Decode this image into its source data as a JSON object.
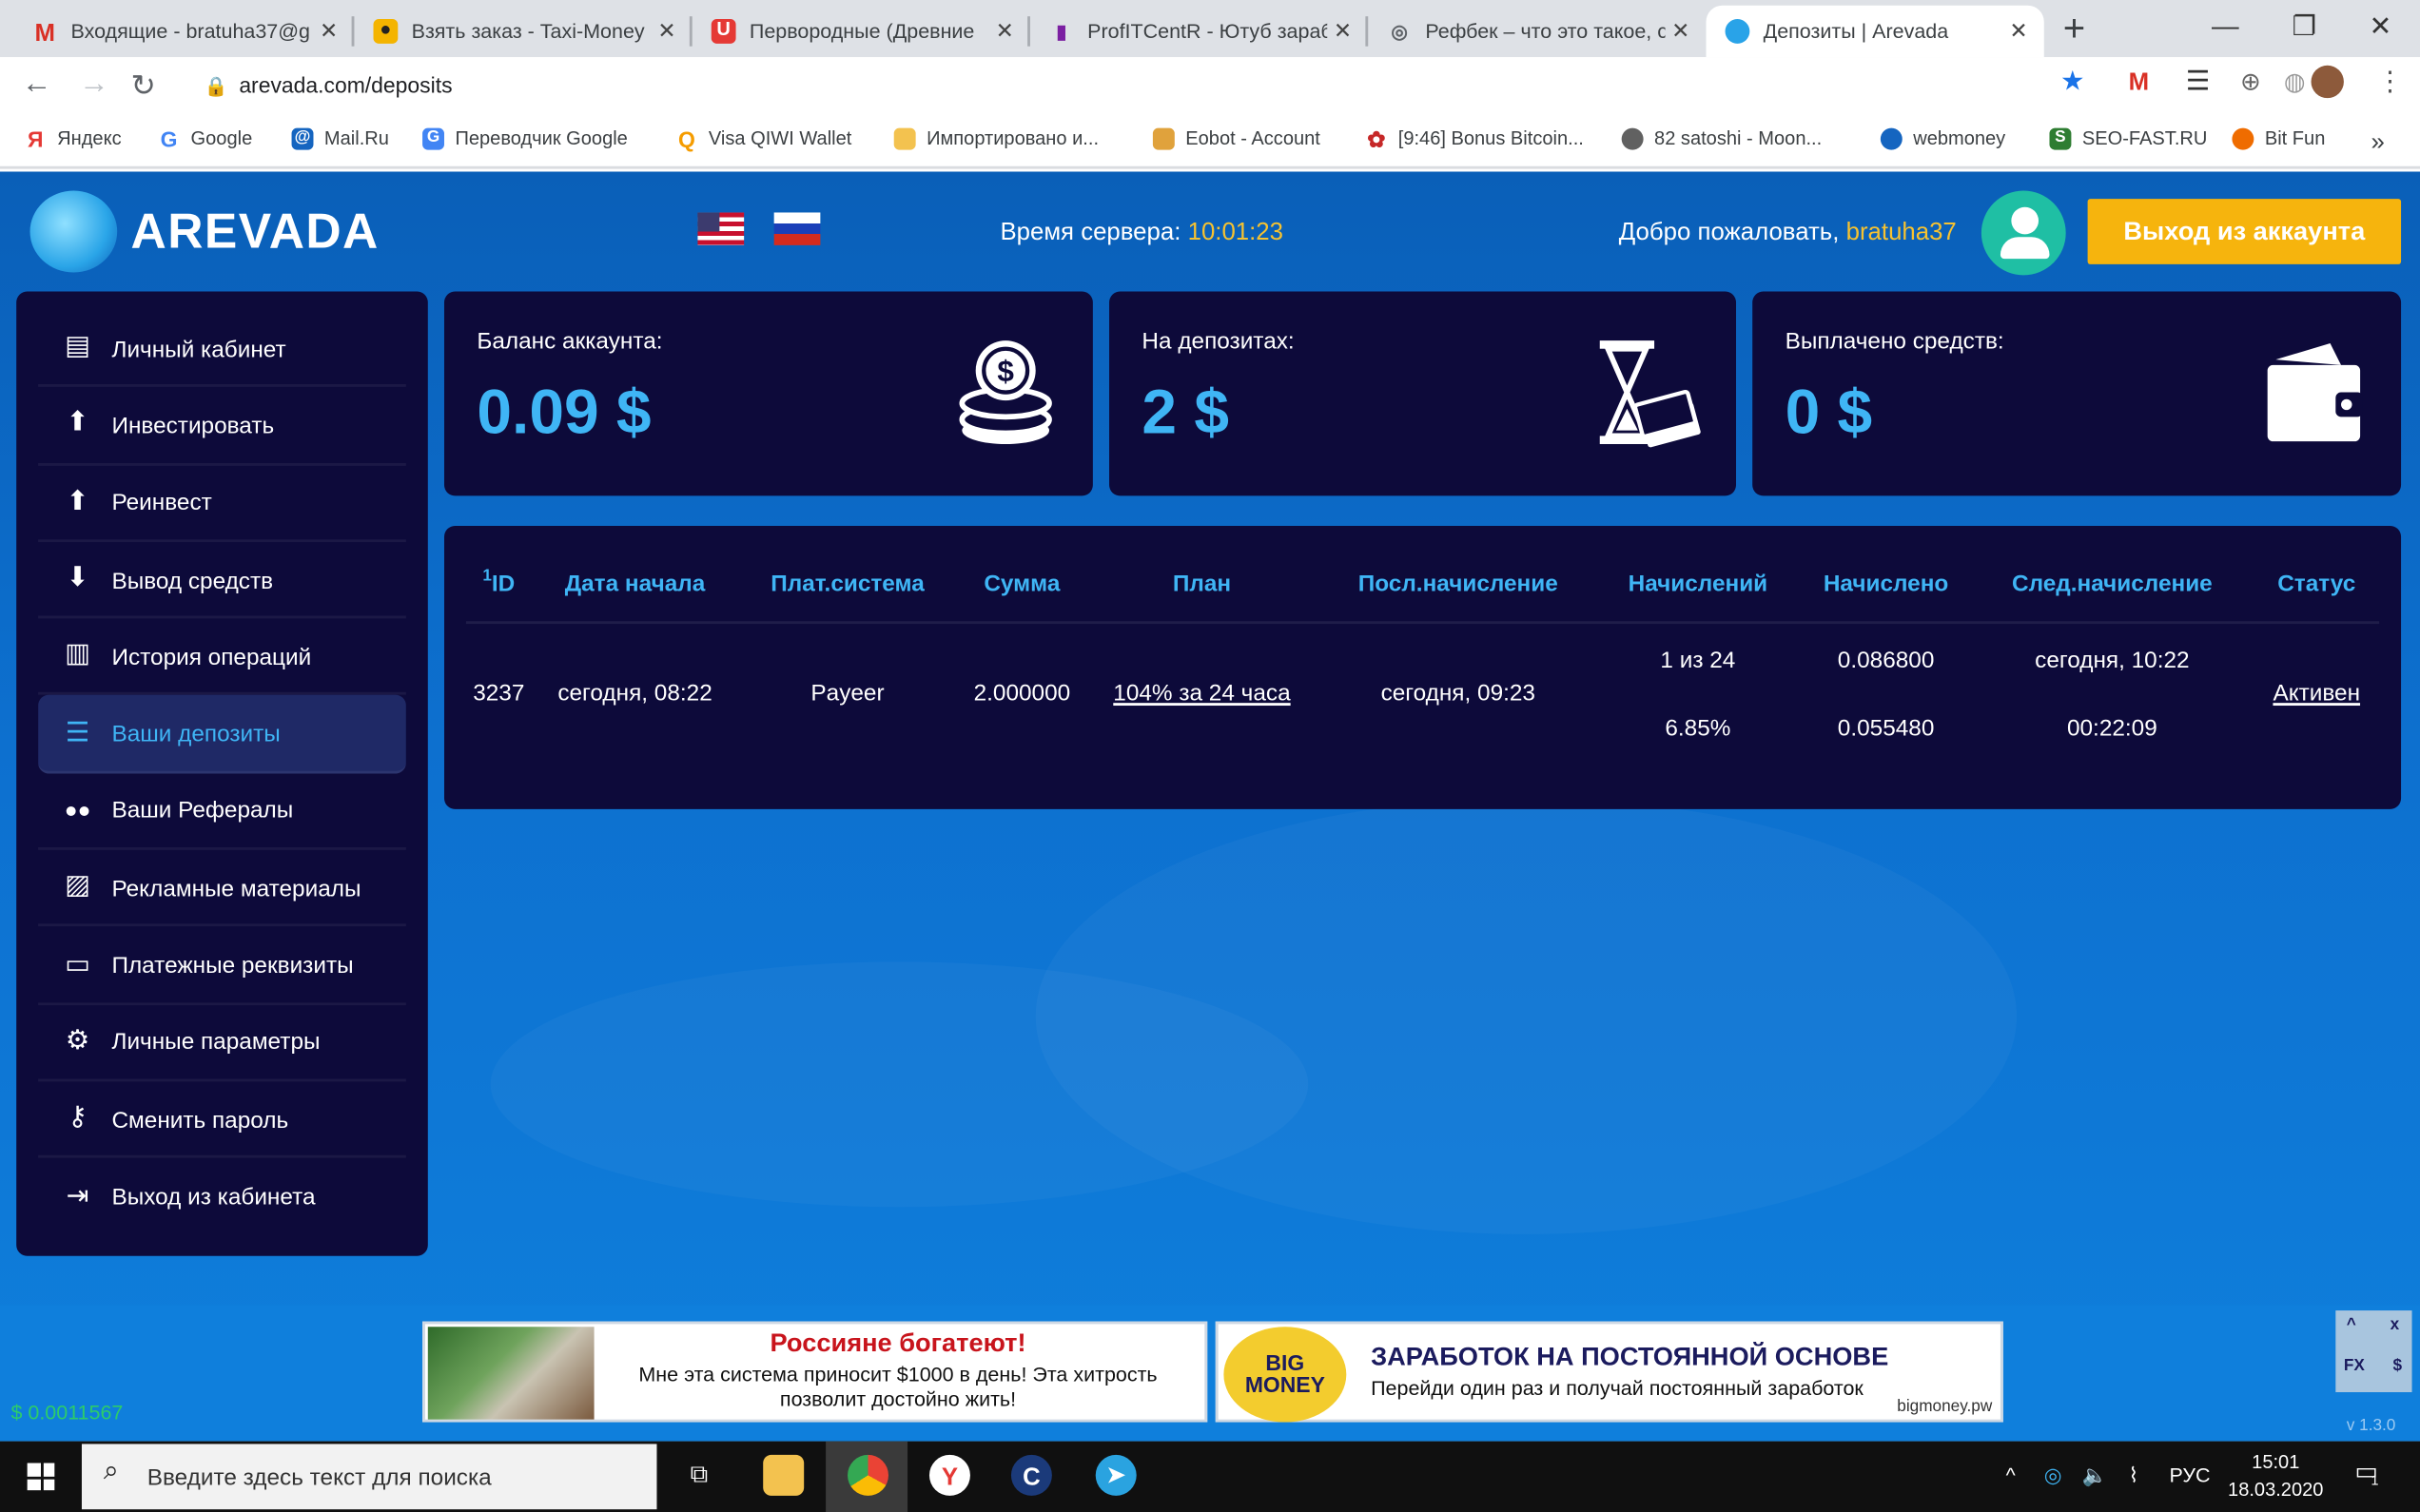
{
  "browser": {
    "tabs": [
      {
        "title": "Входящие - bratuha37@g",
        "icon": "gmail-icon",
        "color": "#d93025",
        "glyph": "M"
      },
      {
        "title": "Взять заказ - Taxi-Money",
        "icon": "taxi-icon",
        "color": "#f4b400",
        "glyph": "●"
      },
      {
        "title": "Первородные (Древние",
        "icon": "film-icon",
        "color": "#e53935",
        "glyph": "U"
      },
      {
        "title": "ProfITCentR - Ютуб зараб",
        "icon": "chart-icon",
        "color": "#7b1fa2",
        "glyph": "▮"
      },
      {
        "title": "Рефбек – что это такое, с",
        "icon": "globe-icon",
        "color": "#5f6368",
        "glyph": "◎"
      },
      {
        "title": "Депозиты | Arevada",
        "icon": "arevada-icon",
        "color": "#29a3e8",
        "glyph": "●"
      }
    ],
    "new_tab": "+",
    "window_controls": {
      "minimize": "—",
      "restore": "❐",
      "close": "✕"
    },
    "url": "arevada.com/deposits",
    "bookmarks": [
      {
        "label": "Яндекс",
        "color": "#e53935",
        "glyph": "Я"
      },
      {
        "label": "Google",
        "color": "#4285f4",
        "glyph": "G"
      },
      {
        "label": "Mail.Ru",
        "color": "#1565c0",
        "glyph": "@"
      },
      {
        "label": "Переводчик Google",
        "color": "#4285f4",
        "glyph": "G"
      },
      {
        "label": "Visa QIWI Wallet",
        "color": "#f59c00",
        "glyph": "Q"
      },
      {
        "label": "Импортировано и...",
        "color": "#f3c24f",
        "glyph": "▬"
      },
      {
        "label": "Eobot - Account",
        "color": "#e0a23c",
        "glyph": "▬"
      },
      {
        "label": "[9:46] Bonus Bitcoin...",
        "color": "#c62828",
        "glyph": "✿"
      },
      {
        "label": "82 satoshi - Moon...",
        "color": "#616161",
        "glyph": "●"
      },
      {
        "label": "webmoney",
        "color": "#1565c0",
        "glyph": "◎"
      },
      {
        "label": "SEO-FAST.RU",
        "color": "#2e7d32",
        "glyph": "S"
      },
      {
        "label": "Bit Fun",
        "color": "#ef6c00",
        "glyph": "●"
      }
    ],
    "bookmarks_more": "»"
  },
  "header": {
    "logo_text": "AREVADA",
    "server_time_label": "Время сервера:",
    "server_time": "10:01:23",
    "welcome_label": "Добро пожаловать,",
    "username": "bratuha37",
    "logout_label": "Выход из аккаунта"
  },
  "sidebar": {
    "items": [
      {
        "label": "Личный кабинет",
        "icon": "id-card-icon",
        "glyph": "▤"
      },
      {
        "label": "Инвестировать",
        "icon": "arrow-up-circle-icon",
        "glyph": "⬆"
      },
      {
        "label": "Реинвест",
        "icon": "arrow-up-circle-icon",
        "glyph": "⬆"
      },
      {
        "label": "Вывод средств",
        "icon": "arrow-down-circle-icon",
        "glyph": "⬇"
      },
      {
        "label": "История операций",
        "icon": "bar-chart-icon",
        "glyph": "▥"
      },
      {
        "label": "Ваши депозиты",
        "icon": "list-icon",
        "glyph": "☰",
        "active": true
      },
      {
        "label": "Ваши Рефералы",
        "icon": "users-icon",
        "glyph": "👥"
      },
      {
        "label": "Рекламные материалы",
        "icon": "images-icon",
        "glyph": "▨"
      },
      {
        "label": "Платежные реквизиты",
        "icon": "credit-card-icon",
        "glyph": "▭"
      },
      {
        "label": "Личные параметры",
        "icon": "gears-icon",
        "glyph": "⚙"
      },
      {
        "label": "Сменить пароль",
        "icon": "key-icon",
        "glyph": "⚷"
      },
      {
        "label": "Выход из кабинета",
        "icon": "sign-out-icon",
        "glyph": "⇥"
      }
    ]
  },
  "cards": [
    {
      "label": "Баланс аккаунта:",
      "value": "0.09 $",
      "icon": "coins-icon"
    },
    {
      "label": "На депозитах:",
      "value": "2 $",
      "icon": "hourglass-money-icon"
    },
    {
      "label": "Выплачено средств:",
      "value": "0 $",
      "icon": "wallet-icon"
    }
  ],
  "deposits": {
    "headers": {
      "id_prefix": "1",
      "id": "ID",
      "start": "Дата начала",
      "paysys": "Плат.система",
      "amount": "Сумма",
      "plan": "План",
      "last_accrual": "Посл.начисление",
      "accruals": "Начислений",
      "accrued": "Начислено",
      "next_accrual": "След.начисление",
      "status": "Статус"
    },
    "row": {
      "id": "3237",
      "start": "сегодня, 08:22",
      "paysys": "Payeer",
      "amount": "2.000000",
      "plan": "104% за 24 часа",
      "last_accrual": "сегодня, 09:23",
      "accruals": "1 из 24",
      "accruals_pct": "6.85%",
      "accrued": "0.086800",
      "accrued_2": "0.055480",
      "next_accrual": "сегодня, 10:22",
      "next_accrual_2": "00:22:09",
      "status": "Активен"
    }
  },
  "footer": {
    "small_value": "$ 0.0011567",
    "version": "v 1.3.0",
    "ad1": {
      "headline": "Россияне богатеют!",
      "text": "Мне эта система приносит $1000 в день! Эта хитрость позволит достойно жить!"
    },
    "ad2": {
      "badge_top": "BIG",
      "badge_bottom": "MONEY",
      "headline": "ЗАРАБОТОК НА ПОСТОЯННОЙ ОСНОВЕ",
      "text": "Перейди один раз и получай постоянный заработок",
      "url": "bigmoney.pw"
    },
    "adctl": {
      "up": "^",
      "close": "x",
      "fx": "FX",
      "usd": "$"
    }
  },
  "taskbar": {
    "search_placeholder": "Введите здесь текст для поиска",
    "lang": "РУС",
    "time": "15:01",
    "date": "18.03.2020",
    "notifications": "1"
  }
}
